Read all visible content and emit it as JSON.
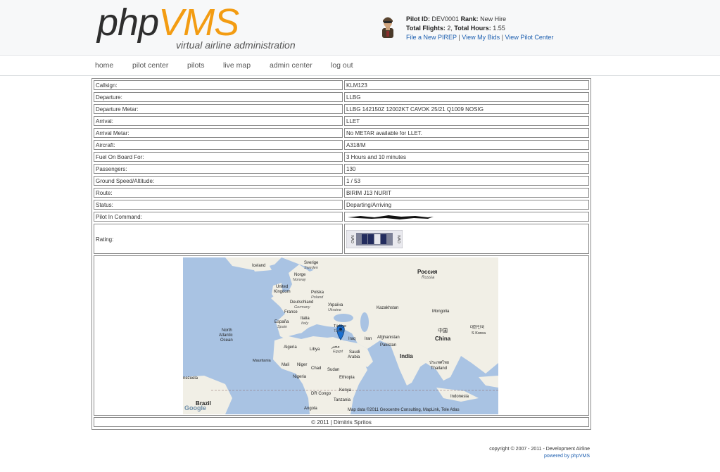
{
  "logo": {
    "php": "php",
    "vms": "VMS",
    "tagline": "virtual airline administration"
  },
  "pilot": {
    "id_label": "Pilot ID:",
    "id": "DEV0001",
    "rank_label": "Rank:",
    "rank": "New Hire",
    "flights_label": "Total Flights:",
    "flights": "2,",
    "hours_label": "Total Hours:",
    "hours": "1.55",
    "link_pirep": "File a New PIREP",
    "link_bids": "View My Bids",
    "link_center": "View Pilot Center",
    "sep": "|"
  },
  "nav": [
    "home",
    "pilot center",
    "pilots",
    "live map",
    "admin center",
    "log out"
  ],
  "details": [
    {
      "label": "Callsign:",
      "value": "KLM123"
    },
    {
      "label": "Departure:",
      "value": "LLBG"
    },
    {
      "label": "Departure Metar:",
      "value": "LLBG 142150Z 12002KT CAVOK 25/21 Q1009 NOSIG"
    },
    {
      "label": "Arrival:",
      "value": "LLET"
    },
    {
      "label": "Arrival Metar:",
      "value": "No METAR available for LLET."
    },
    {
      "label": "Aircraft:",
      "value": "A318/M"
    },
    {
      "label": "Fuel On Board For:",
      "value": "3 Hours and 10 minutes"
    },
    {
      "label": "Passengers:",
      "value": "130"
    },
    {
      "label": "Ground Speed/Altitude:",
      "value": "1 / 53"
    },
    {
      "label": "Route:",
      "value": "BIRIM J13 NURIT"
    },
    {
      "label": "Status:",
      "value": "Departing/Arriving"
    },
    {
      "label": "Pilot In Command:",
      "value": ""
    }
  ],
  "rating": {
    "label": "Rating:",
    "badge_left": "IVAO",
    "badge_right": "IVAO"
  },
  "map": {
    "labels": {
      "iceland": "Iceland",
      "sverige": "Sverige",
      "sweden": "Sweden",
      "norge": "Norge",
      "norway": "Norway",
      "russia_native": "Россия",
      "russia": "Russia",
      "uk": "United",
      "uk2": "Kingdom",
      "polska": "Polska",
      "poland": "Poland",
      "deutschland": "Deutschland",
      "germany": "Germany",
      "ukraine_native": "Україна",
      "ukraine": "Ukraine",
      "france": "France",
      "espana": "España",
      "spain": "Spain",
      "italia": "Italia",
      "italy": "Italy",
      "kazakhstan": "Kazakhstan",
      "mongolia": "Mongolia",
      "china_native": "中国",
      "china": "China",
      "korea_native": "대한민국",
      "korea": "S Korea",
      "turkiye": "Türkiye",
      "turkey": "Turkey",
      "iraq": "Iraq",
      "iran": "Iran",
      "afghanistan": "Afghanistan",
      "pakistan": "Pakistan",
      "india": "India",
      "thailand_native": "ประเทศไทย",
      "thailand": "Thailand",
      "north_atlantic": "North",
      "north_atlantic2": "Atlantic",
      "north_atlantic3": "Ocean",
      "algeria": "Algeria",
      "libya": "Libya",
      "egypt_native": "مصر",
      "egypt": "Egypt",
      "saudi": "Saudi",
      "saudi2": "Arabia",
      "mauritania": "Mauritania",
      "mali": "Mali",
      "niger": "Niger",
      "chad": "Chad",
      "sudan": "Sudan",
      "nigeria": "Nigeria",
      "ethiopia": "Ethiopia",
      "venezuela": "nezuela",
      "dr_congo": "DR Congo",
      "kenya": "Kenya",
      "tanzania": "Tanzania",
      "indonesia": "Indonesia",
      "brazil": "Brazil",
      "angola": "Angola",
      "google": "Google"
    },
    "attribution": "Map data ©2011 Geocentre Consulting, MapLink, Tele Atlas"
  },
  "table_footer": "© 2011 | Dimitris Spritos",
  "footer": {
    "copyright": "copyright © 2007 - 2011 - Development Airline",
    "powered": "powered by phpVMS"
  }
}
